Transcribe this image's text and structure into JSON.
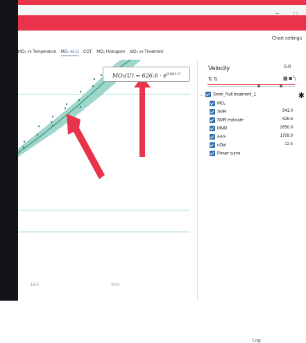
{
  "window": {
    "minimize_icon": "minimize-icon",
    "maximize_icon": "maximize-icon",
    "minimize_glyph": "−",
    "maximize_glyph": "□"
  },
  "toolbar": {
    "chart_settings_label": "Chart settings"
  },
  "tabs": [
    {
      "label": "MO₂ vs Temperature",
      "active": false
    },
    {
      "label": "MO₂ vs U",
      "active": true
    },
    {
      "label": "COT",
      "active": false
    },
    {
      "label": "MO₂ Histogram",
      "active": false
    },
    {
      "label": "MO₂ vs Treatment",
      "active": false
    }
  ],
  "plot": {
    "equation_lhs": "MO₂(U) = 626.6 · e",
    "equation_exp": "0.081·U",
    "x_ticks": [
      "15.0",
      "20.0"
    ],
    "log_label": "Log",
    "colors": {
      "band": "#8ecfc3",
      "points": "#2e7d72",
      "annotation_arrow": "#e8334a",
      "ref_lines": "#a8d8d8"
    }
  },
  "side_panel": {
    "title": "Velocity",
    "title_value": "0.0",
    "sort_icons": "⇅ ⇅",
    "tool_icons": "▩ ◙ ╲",
    "group_label": "Swim_Null treatment_1",
    "series": [
      {
        "name": "MO₂",
        "value": ""
      },
      {
        "name": "SMR",
        "value": "941.0"
      },
      {
        "name": "SMR estimate",
        "value": "626.6"
      },
      {
        "name": "MMR",
        "value": "2650.0"
      },
      {
        "name": "AAS",
        "value": "1709.0"
      },
      {
        "name": "uOpt",
        "value": "12.4"
      },
      {
        "name": "Power curve",
        "value": ""
      }
    ]
  }
}
